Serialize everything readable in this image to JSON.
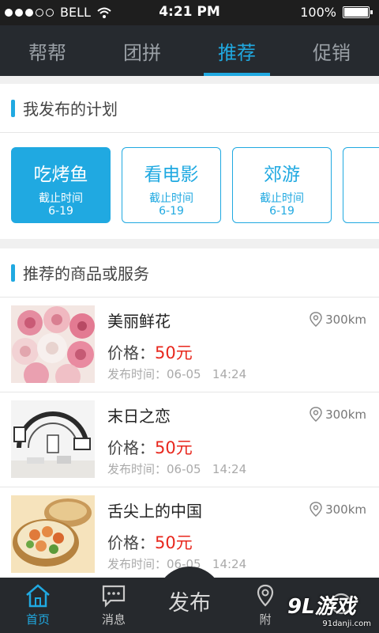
{
  "status": {
    "carrier": "BELL",
    "time": "4:21 PM",
    "battery": "100%"
  },
  "tabs": [
    {
      "label": "帮帮"
    },
    {
      "label": "团拼"
    },
    {
      "label": "推荐"
    },
    {
      "label": "促销"
    }
  ],
  "plans_section": {
    "title": "我发布的计划",
    "plans": [
      {
        "name": "吃烤鱼",
        "deadline_label": "截止时间",
        "deadline": "6-19"
      },
      {
        "name": "看电影",
        "deadline_label": "截止时间",
        "deadline": "6-19"
      },
      {
        "name": "郊游",
        "deadline_label": "截止时间",
        "deadline": "6-19"
      }
    ]
  },
  "rec_section": {
    "title": "推荐的商品或服务",
    "items": [
      {
        "name": "美丽鲜花",
        "price_label": "价格：",
        "price": "50元",
        "distance": "300km",
        "time_label": "发布时间：",
        "time": "06-05   14:24"
      },
      {
        "name": "末日之恋",
        "price_label": "价格：",
        "price": "50元",
        "distance": "300km",
        "time_label": "发布时间：",
        "time": "06-05   14:24"
      },
      {
        "name": "舌尖上的中国",
        "price_label": "价格：",
        "price": "50元",
        "distance": "300km",
        "time_label": "发布时间：",
        "time": "06-05   14:24"
      }
    ]
  },
  "bottom_nav": {
    "home": "首页",
    "messages": "消息",
    "publish": "发布",
    "nearby": "附"
  },
  "watermark": {
    "main": "9L游戏",
    "sub": "91danji.com"
  },
  "colors": {
    "accent": "#20a9e1",
    "price": "#e8271d",
    "nav_bg": "#262a2f"
  }
}
